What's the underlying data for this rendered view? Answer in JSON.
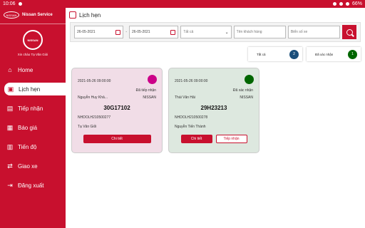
{
  "statusbar": {
    "time": "10:06",
    "battery": "66%"
  },
  "colors": {
    "brand": "#c8102e",
    "pending": "#cc0088",
    "confirmed": "#006600",
    "all_badge": "#1a4e7a"
  },
  "sidebar": {
    "app_title": "Nissan Service",
    "logo_text": "NISSAN",
    "greeting": "Xin chào Tạ Văn Giỏi",
    "items": [
      {
        "label": "Home",
        "icon": "home-icon"
      },
      {
        "label": "Lịch hẹn",
        "icon": "calendar-icon"
      },
      {
        "label": "Tiếp nhận",
        "icon": "document-icon"
      },
      {
        "label": "Báo giá",
        "icon": "invoice-icon"
      },
      {
        "label": "Tiến độ",
        "icon": "chart-icon"
      },
      {
        "label": "Giao xe",
        "icon": "handover-icon"
      },
      {
        "label": "Đăng xuất",
        "icon": "logout-icon"
      }
    ]
  },
  "page": {
    "title": "Lịch hẹn"
  },
  "filters": {
    "date_from": "26-05-2021",
    "date_to": "26-05-2021",
    "status_value": "Tất cả",
    "customer_placeholder": "Tên khách hàng",
    "plate_placeholder": "Biển số xe"
  },
  "stats": [
    {
      "label": "Tất cả",
      "count": "2"
    },
    {
      "label": "Đã xác nhận",
      "count": "1"
    }
  ],
  "cards": [
    {
      "datetime": "2021-05-26 09:00:00",
      "status": "Đã tiếp nhận",
      "customer": "Nguyễn Huy Khả...",
      "brand": "NISSAN",
      "plate": "30G17102",
      "code": "NHDOLH210500277",
      "advisor": "Tạ Văn Giỏi",
      "detail_label": "Chi tiết"
    },
    {
      "datetime": "2021-05-26 09:00:00",
      "status": "Đã xác nhận",
      "customer": "Thái Văn Hải",
      "brand": "NISSAN",
      "plate": "29H23213",
      "code": "NHDOLH210500278",
      "advisor": "Nguyễn Tiến Thành",
      "detail_label": "Chi tiết",
      "receive_label": "Tiếp nhận"
    }
  ]
}
